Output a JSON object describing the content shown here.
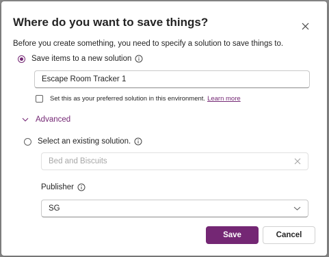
{
  "dialog": {
    "title": "Where do you want to save things?",
    "intro": "Before you create something, you need to specify a solution to save things to."
  },
  "new_solution": {
    "label": "Save items to a new solution",
    "selected": true,
    "name_value": "Escape Room Tracker 1",
    "preferred_label": "Set this as your preferred solution in this environment.",
    "learn_more": "Learn more"
  },
  "advanced": {
    "label": "Advanced",
    "expanded": true
  },
  "existing_solution": {
    "label": "Select an existing solution.",
    "selected": false,
    "value": "Bed and Biscuits"
  },
  "publisher": {
    "label": "Publisher",
    "value": "SG"
  },
  "buttons": {
    "save": "Save",
    "cancel": "Cancel"
  },
  "colors": {
    "accent": "#742774",
    "overlay": "#8a8a8a"
  }
}
